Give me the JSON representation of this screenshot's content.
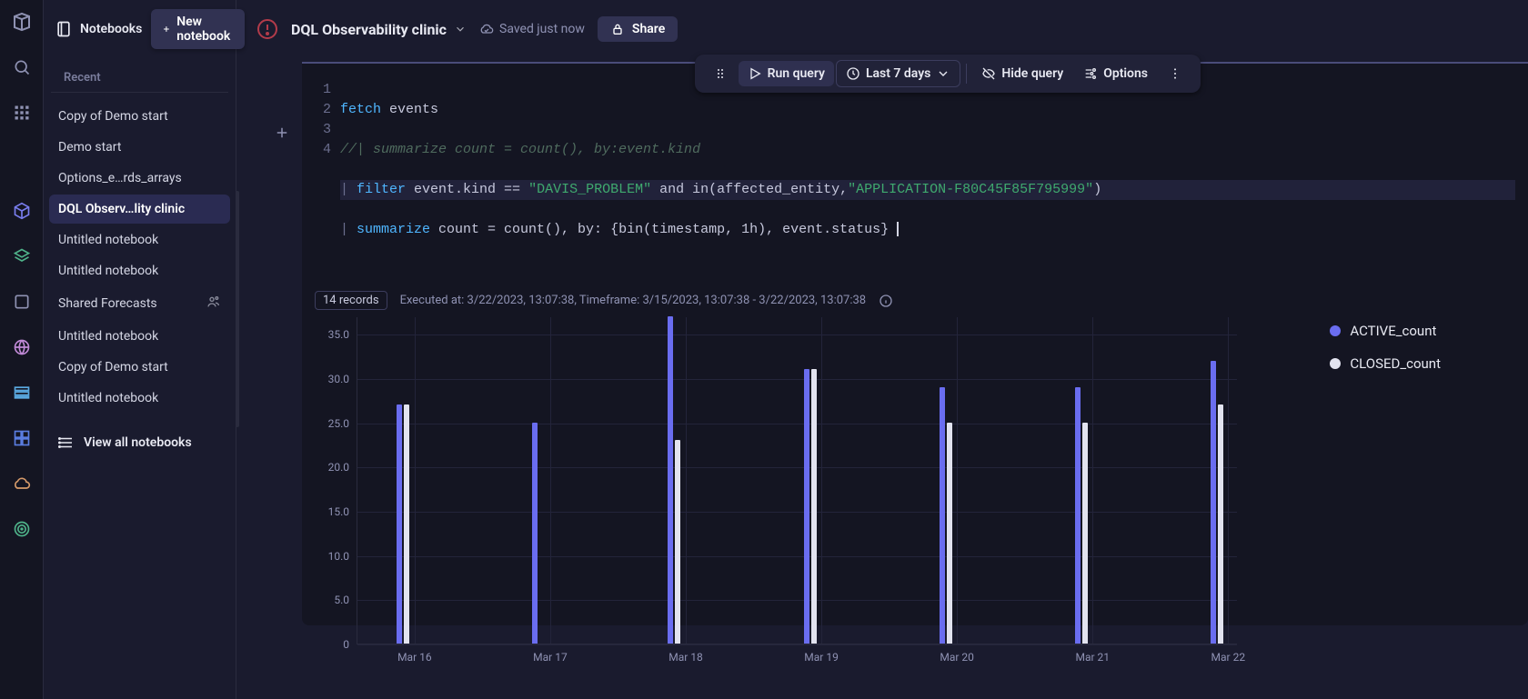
{
  "nav_rail_icons": [
    "logo",
    "search",
    "apps",
    "cube",
    "layers",
    "box",
    "globe",
    "rows",
    "grid",
    "cloud",
    "bullseye"
  ],
  "sidebar": {
    "notebooks_label": "Notebooks",
    "new_button": "New notebook",
    "recent_label": "Recent",
    "items": [
      {
        "label": "Copy of Demo start",
        "active": false,
        "shared": false
      },
      {
        "label": "Demo start",
        "active": false,
        "shared": false
      },
      {
        "label": "Options_e…rds_arrays",
        "active": false,
        "shared": false
      },
      {
        "label": "DQL Observ…lity clinic",
        "active": true,
        "shared": false
      },
      {
        "label": "Untitled notebook",
        "active": false,
        "shared": false
      },
      {
        "label": "Untitled notebook",
        "active": false,
        "shared": false
      },
      {
        "label": "Shared Forecasts",
        "active": false,
        "shared": true
      },
      {
        "label": "Untitled notebook",
        "active": false,
        "shared": false
      },
      {
        "label": "Copy of Demo start",
        "active": false,
        "shared": false
      },
      {
        "label": "Untitled notebook",
        "active": false,
        "shared": false
      }
    ],
    "view_all_label": "View all notebooks"
  },
  "title_bar": {
    "title": "DQL Observability clinic",
    "saved_text": "Saved just now",
    "share_label": "Share"
  },
  "card_toolbar": {
    "run_label": "Run query",
    "time_label": "Last 7 days",
    "hide_label": "Hide query",
    "options_label": "Options"
  },
  "code": {
    "line_numbers": [
      "1",
      "2",
      "3",
      "4"
    ],
    "line1_kw": "fetch",
    "line1_rest": " events",
    "line2_comment": "//| summarize count = count(), by:event.kind",
    "line3_pipe": "| ",
    "line3_kw": "filter",
    "line3_mid_a": " event.kind == ",
    "line3_str1": "\"DAVIS_PROBLEM\"",
    "line3_mid_b": " and in(affected_entity,",
    "line3_str2": "\"APPLICATION-F80C45F85F795999\"",
    "line3_end": ")",
    "line4_pipe": "| ",
    "line4_kw": "summarize",
    "line4_rest": " count = count(), by: {bin(timestamp, 1h), event.status}"
  },
  "exec": {
    "records": "14 records",
    "info": "Executed at: 3/22/2023, 13:07:38, Timeframe: 3/15/2023, 13:07:38 - 3/22/2023, 13:07:38"
  },
  "chart_data": {
    "type": "bar",
    "categories": [
      "Mar 16",
      "Mar 17",
      "Mar 18",
      "Mar 19",
      "Mar 20",
      "Mar 21",
      "Mar 22"
    ],
    "series": [
      {
        "name": "ACTIVE_count",
        "values": [
          27,
          25,
          37,
          31,
          29,
          29,
          32
        ]
      },
      {
        "name": "CLOSED_count",
        "values": [
          27,
          null,
          23,
          31,
          25,
          25,
          27
        ]
      }
    ],
    "ylabel": "",
    "xlabel": "",
    "ylim": [
      0,
      37
    ],
    "yticks": [
      0,
      5.0,
      10.0,
      15.0,
      20.0,
      25.0,
      30.0,
      35.0
    ],
    "ytick_labels": [
      "0",
      "5.0",
      "10.0",
      "15.0",
      "20.0",
      "25.0",
      "30.0",
      "35.0"
    ]
  },
  "legend": {
    "active": "ACTIVE_count",
    "closed": "CLOSED_count"
  }
}
